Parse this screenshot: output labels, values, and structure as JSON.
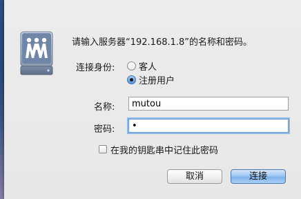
{
  "dialog": {
    "icon": "network-server-icon",
    "prompt": "请输入服务器“192.168.1.8”的名称和密码。"
  },
  "connect_as": {
    "label": "连接身份:",
    "options": [
      {
        "label": "客人",
        "selected": false
      },
      {
        "label": "注册用户",
        "selected": true
      }
    ]
  },
  "fields": {
    "name_label": "名称:",
    "name_value": "mutou",
    "password_label": "密码:",
    "password_value": "•"
  },
  "remember": {
    "label": "在我的钥匙串中记住此密码",
    "checked": false
  },
  "buttons": {
    "cancel": "取消",
    "connect": "连接"
  },
  "colors": {
    "focus_ring": "#8fb6e8",
    "default_button": "#7fb0ec"
  }
}
